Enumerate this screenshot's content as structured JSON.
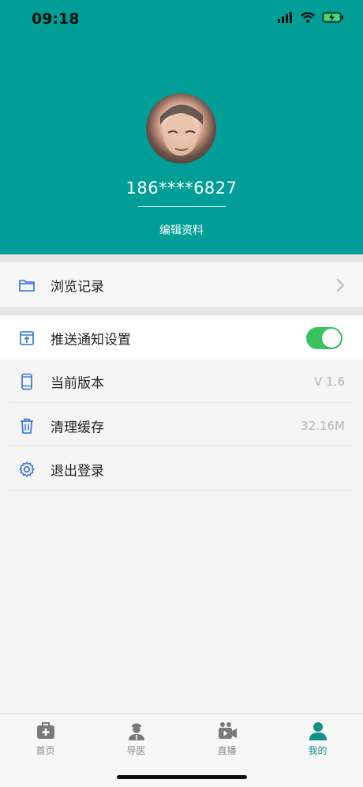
{
  "status_bar": {
    "time": "09:18"
  },
  "profile": {
    "phone": "186****6827",
    "edit_label": "编辑资料"
  },
  "menu": {
    "browse_history": "浏览记录",
    "push_settings": "推送通知设置",
    "push_enabled": true,
    "current_version_label": "当前版本",
    "current_version_value": "V 1.6",
    "clear_cache_label": "清理缓存",
    "clear_cache_value": "32.16M",
    "logout_label": "退出登录"
  },
  "tabbar": {
    "items": [
      {
        "label": "首页",
        "icon": "medical-kit-icon"
      },
      {
        "label": "导医",
        "icon": "doctor-icon"
      },
      {
        "label": "直播",
        "icon": "video-camera-icon"
      },
      {
        "label": "我的",
        "icon": "user-icon"
      }
    ],
    "active_index": 3
  },
  "colors": {
    "header": "#009e96",
    "accent": "#138f88",
    "toggle_on": "#3ac35c",
    "icon_blue": "#2c6fd6"
  }
}
